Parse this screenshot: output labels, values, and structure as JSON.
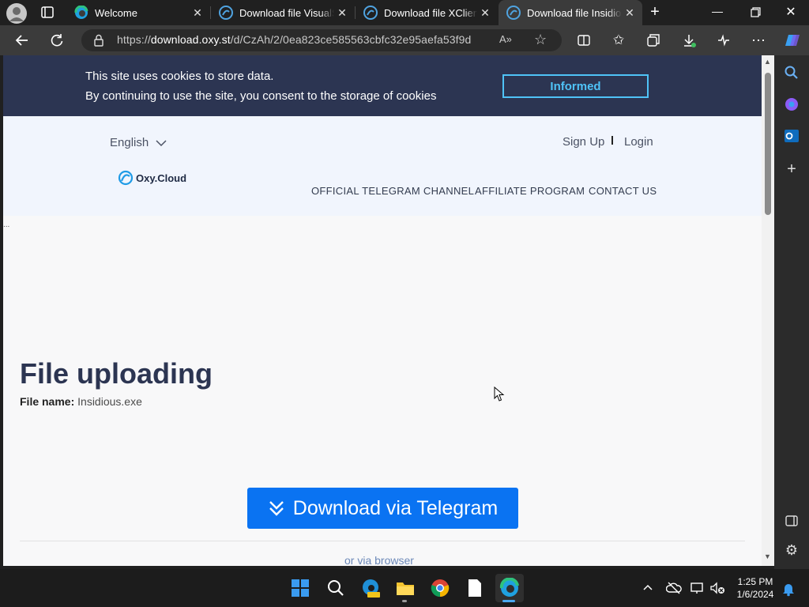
{
  "tabs": [
    {
      "title": "Welcome"
    },
    {
      "title": "Download file VisualStudio"
    },
    {
      "title": "Download file XClient"
    },
    {
      "title": "Download file Insidious"
    }
  ],
  "address": {
    "scheme": "https://",
    "host": "download.oxy.st",
    "path": "/d/CzAh/2/0ea823ce585563cbfc32e95aefa53f9d"
  },
  "cookie": {
    "line1": "This site uses cookies to store data.",
    "line2": "By continuing to use the site, you consent to the storage of cookies",
    "button": "Informed"
  },
  "header": {
    "language": "English",
    "signup": "Sign Up",
    "login": "Login",
    "logo": "Oxy.Cloud",
    "nav": [
      "OFFICIAL TELEGRAM CHANNEL",
      "AFFILIATE PROGRAM",
      "CONTACT US"
    ]
  },
  "main": {
    "title": "File uploading",
    "file_label": "File name:",
    "file_name": "Insidious.exe",
    "download_button": "Download via Telegram",
    "browser_link": "or via browser",
    "ellipsis": "..."
  },
  "taskbar": {
    "time": "1:25 PM",
    "date": "1/6/2024"
  },
  "colors": {
    "cookie_bg": "#2c3552",
    "accent": "#4fc3f7",
    "download_btn": "#0a73f2",
    "title": "#2c3552"
  }
}
